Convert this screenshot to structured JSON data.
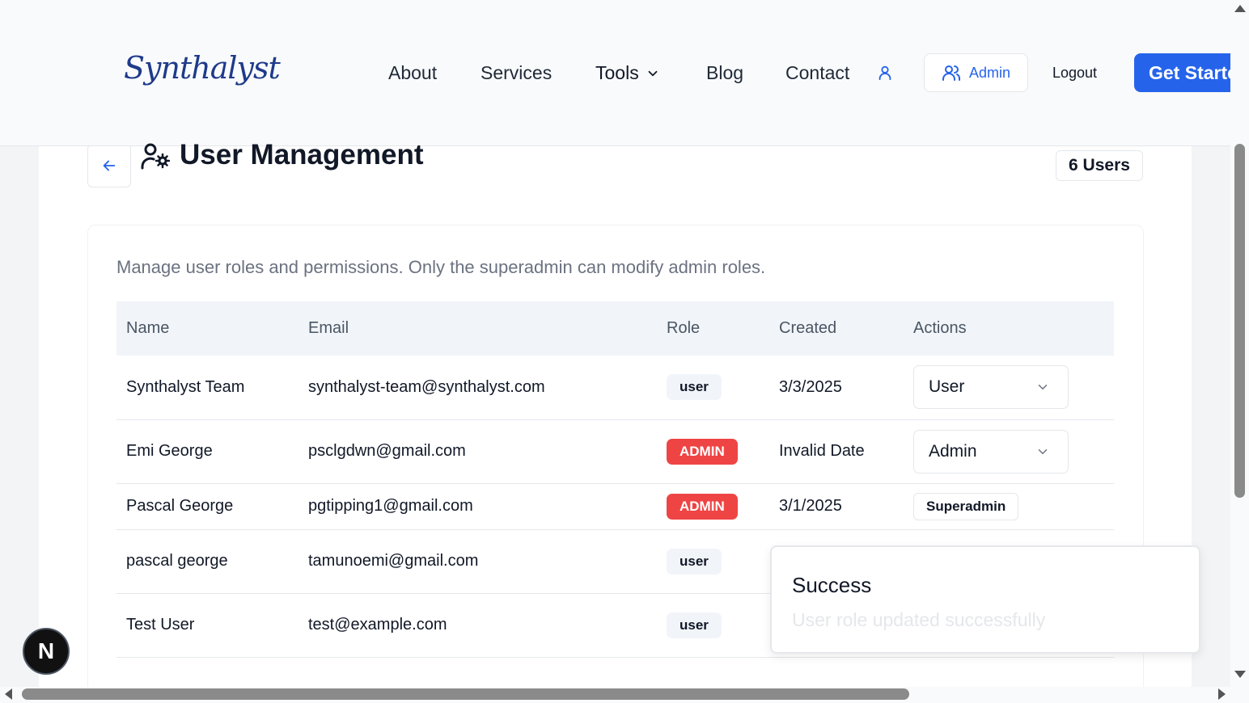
{
  "header": {
    "logo": "Synthalyst",
    "nav": [
      "About",
      "Services",
      "Tools",
      "Blog",
      "Contact"
    ],
    "admin_label": "Admin",
    "logout_label": "Logout",
    "cta_label": "Get Started"
  },
  "page": {
    "title": "User Management",
    "user_count": "6 Users",
    "description": "Manage user roles and permissions. Only the superadmin can modify admin roles."
  },
  "table": {
    "columns": [
      "Name",
      "Email",
      "Role",
      "Created",
      "Actions"
    ],
    "rows": [
      {
        "name": "Synthalyst Team",
        "email": "synthalyst-team@synthalyst.com",
        "role": "user",
        "created": "3/3/2025",
        "action": "User"
      },
      {
        "name": "Emi George",
        "email": "psclgdwn@gmail.com",
        "role": "ADMIN",
        "created": "Invalid Date",
        "action": "Admin"
      },
      {
        "name": "Pascal George",
        "email": "pgtipping1@gmail.com",
        "role": "ADMIN",
        "created": "3/1/2025",
        "action": "Superadmin"
      },
      {
        "name": "pascal george",
        "email": "tamunoemi@gmail.com",
        "role": "user",
        "created": "",
        "action": ""
      },
      {
        "name": "Test User",
        "email": "test@example.com",
        "role": "user",
        "created": "",
        "action": ""
      }
    ]
  },
  "toast": {
    "title": "Success",
    "message": "User role updated successfully"
  },
  "next_badge": "N",
  "colors": {
    "accent": "#2563eb",
    "admin_badge": "#ef4444",
    "logo": "#1e3a8a"
  }
}
